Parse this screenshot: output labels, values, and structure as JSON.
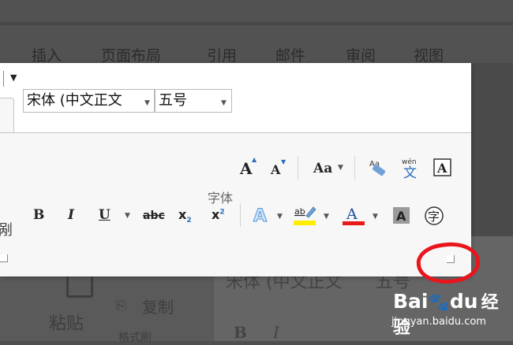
{
  "ribbon": {
    "tabs": [
      "插入",
      "页面布局",
      "引用",
      "邮件",
      "审阅",
      "视图"
    ],
    "font_name": "宋体 (中文正文",
    "font_size": "五号",
    "group_label": "字体",
    "left_partial_char": "剐"
  },
  "background": {
    "paste_label": "粘贴",
    "copy_label": "复制",
    "font_name_ghost": "宋体 (中文正文",
    "font_size_ghost": "五号",
    "format_label": "格式刷"
  },
  "watermark": {
    "brand_pre": "Bai",
    "brand_mid": "du",
    "brand_post": "经验",
    "url": "jingyan.baidu.com"
  },
  "colors": {
    "highlight": "#ffee00",
    "font_color": "#e81b1b",
    "annotation": "#e8161c"
  }
}
